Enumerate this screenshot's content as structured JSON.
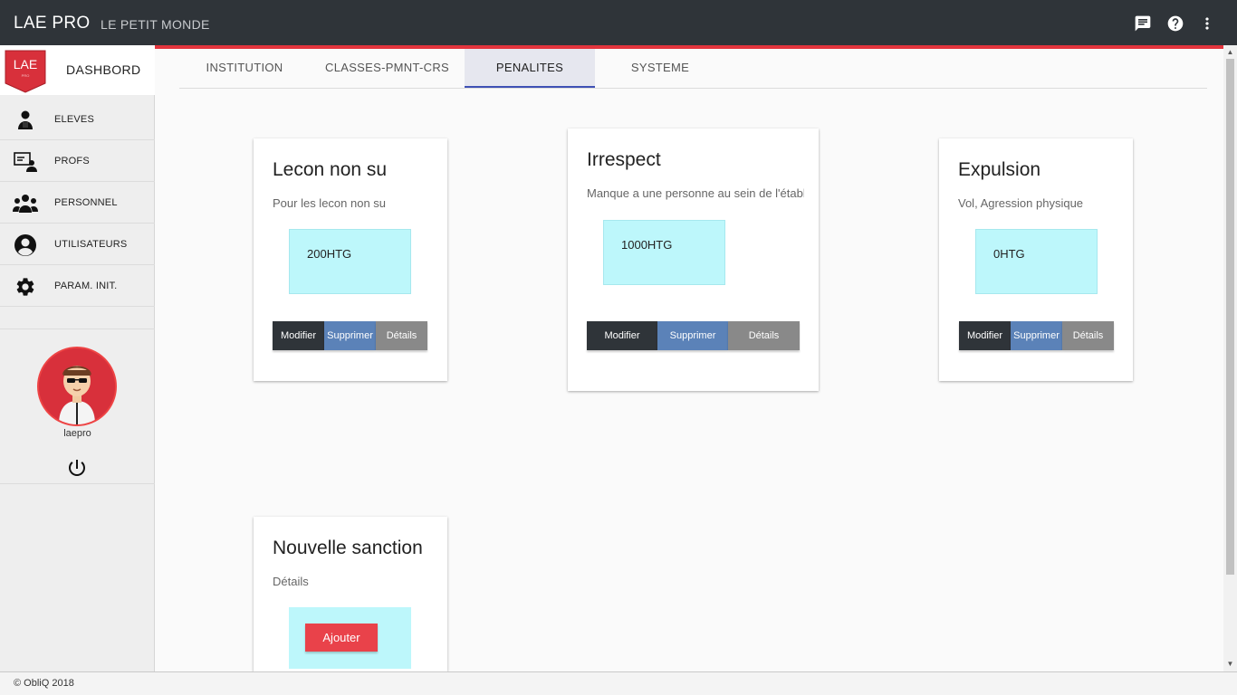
{
  "app": {
    "title": "LAE PRO",
    "subtitle": "LE PETIT MONDE"
  },
  "topbar_icons": [
    "chat-icon",
    "help-icon",
    "more-vert-icon"
  ],
  "sidebar": {
    "logo_text": "LAE",
    "dashboard_label": "DASHBORD",
    "items": [
      {
        "label": "ELEVES",
        "icon": "student-icon"
      },
      {
        "label": "PROFS",
        "icon": "teacher-icon"
      },
      {
        "label": "PERSONNEL",
        "icon": "group-icon"
      },
      {
        "label": "UTILISATEURS",
        "icon": "account-icon"
      },
      {
        "label": "PARAM. INIT.",
        "icon": "gear-icon"
      }
    ],
    "username": "laepro"
  },
  "tabs": [
    {
      "label": "INSTITUTION",
      "active": false
    },
    {
      "label": "CLASSES-PMNT-CRS",
      "active": false
    },
    {
      "label": "PENALITES",
      "active": true
    },
    {
      "label": "SYSTEME",
      "active": false
    }
  ],
  "penalties": [
    {
      "title": "Lecon non su",
      "description": "Pour les lecon non su",
      "price": "200HTG"
    },
    {
      "title": "Irrespect",
      "description": "Manque a une personne au sein de l'établ",
      "price": "1000HTG"
    },
    {
      "title": "Expulsion",
      "description": "Vol, Agression physique",
      "price": "0HTG"
    }
  ],
  "buttons": {
    "modify": "Modifier",
    "delete": "Supprimer",
    "details": "Détails"
  },
  "new_card": {
    "title": "Nouvelle sanction",
    "description": "Détails",
    "add_label": "Ajouter"
  },
  "footer": {
    "text": "© ObliQ 2018"
  },
  "colors": {
    "topbar": "#2f3439",
    "accent_red": "#e3343d",
    "price_box": "#bdf7fb",
    "modify": "#2f3439",
    "delete": "#5b82b8",
    "details": "#898989",
    "add": "#e9424a"
  }
}
